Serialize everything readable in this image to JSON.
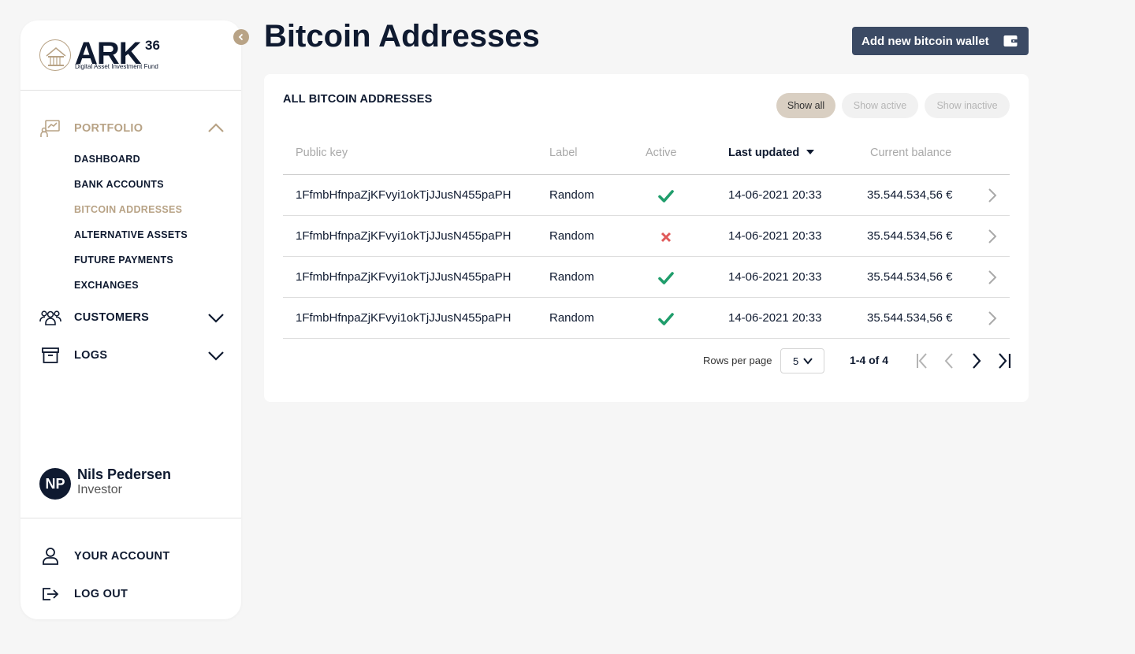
{
  "logo": {
    "name": "ARK",
    "superscript": "36",
    "tagline": "Digital Asset Investment Fund"
  },
  "sidebar": {
    "groups": {
      "portfolio": {
        "label": "PORTFOLIO",
        "icon": "chart-board-icon",
        "expanded": true,
        "items": [
          {
            "label": "DASHBOARD"
          },
          {
            "label": "BANK ACCOUNTS"
          },
          {
            "label": "BITCOIN ADDRESSES",
            "active": true
          },
          {
            "label": "ALTERNATIVE ASSETS"
          },
          {
            "label": "FUTURE PAYMENTS"
          },
          {
            "label": "EXCHANGES"
          }
        ]
      },
      "customers": {
        "label": "CUSTOMERS",
        "icon": "users-group-icon"
      },
      "logs": {
        "label": "LOGS",
        "icon": "archive-box-icon"
      }
    },
    "user": {
      "initials": "NP",
      "name": "Nils Pedersen",
      "role": "Investor"
    },
    "footer": {
      "account_label": "YOUR ACCOUNT",
      "logout_label": "LOG OUT"
    }
  },
  "header": {
    "title": "Bitcoin Addresses",
    "add_button_label": "Add new bitcoin wallet"
  },
  "card": {
    "title": "ALL BITCOIN ADDRESSES",
    "filters": {
      "all": "Show all",
      "active": "Show active",
      "inactive": "Show inactive",
      "selected": "all"
    },
    "columns": {
      "public_key": "Public key",
      "label": "Label",
      "active": "Active",
      "last_updated": "Last updated",
      "current_balance": "Current balance"
    },
    "rows": [
      {
        "public_key": "1FfmbHfnpaZjKFvyi1okTjJJusN455paPH",
        "label": "Random",
        "active": true,
        "last_updated": "14-06-2021 20:33",
        "balance": "35.544.534,56 €"
      },
      {
        "public_key": "1FfmbHfnpaZjKFvyi1okTjJJusN455paPH",
        "label": "Random",
        "active": false,
        "last_updated": "14-06-2021 20:33",
        "balance": "35.544.534,56 €"
      },
      {
        "public_key": "1FfmbHfnpaZjKFvyi1okTjJJusN455paPH",
        "label": "Random",
        "active": true,
        "last_updated": "14-06-2021 20:33",
        "balance": "35.544.534,56 €"
      },
      {
        "public_key": "1FfmbHfnpaZjKFvyi1okTjJJusN455paPH",
        "label": "Random",
        "active": true,
        "last_updated": "14-06-2021 20:33",
        "balance": "35.544.534,56 €"
      }
    ],
    "pagination": {
      "rows_per_page_label": "Rows per page",
      "rows_per_page": "5",
      "range": "1-4 of 4"
    }
  },
  "colors": {
    "accent_gold": "#b8a386",
    "navy": "#0f1a30",
    "button": "#3b4a64",
    "check_green": "#1f9d6b",
    "cross_red": "#e05a5a"
  }
}
